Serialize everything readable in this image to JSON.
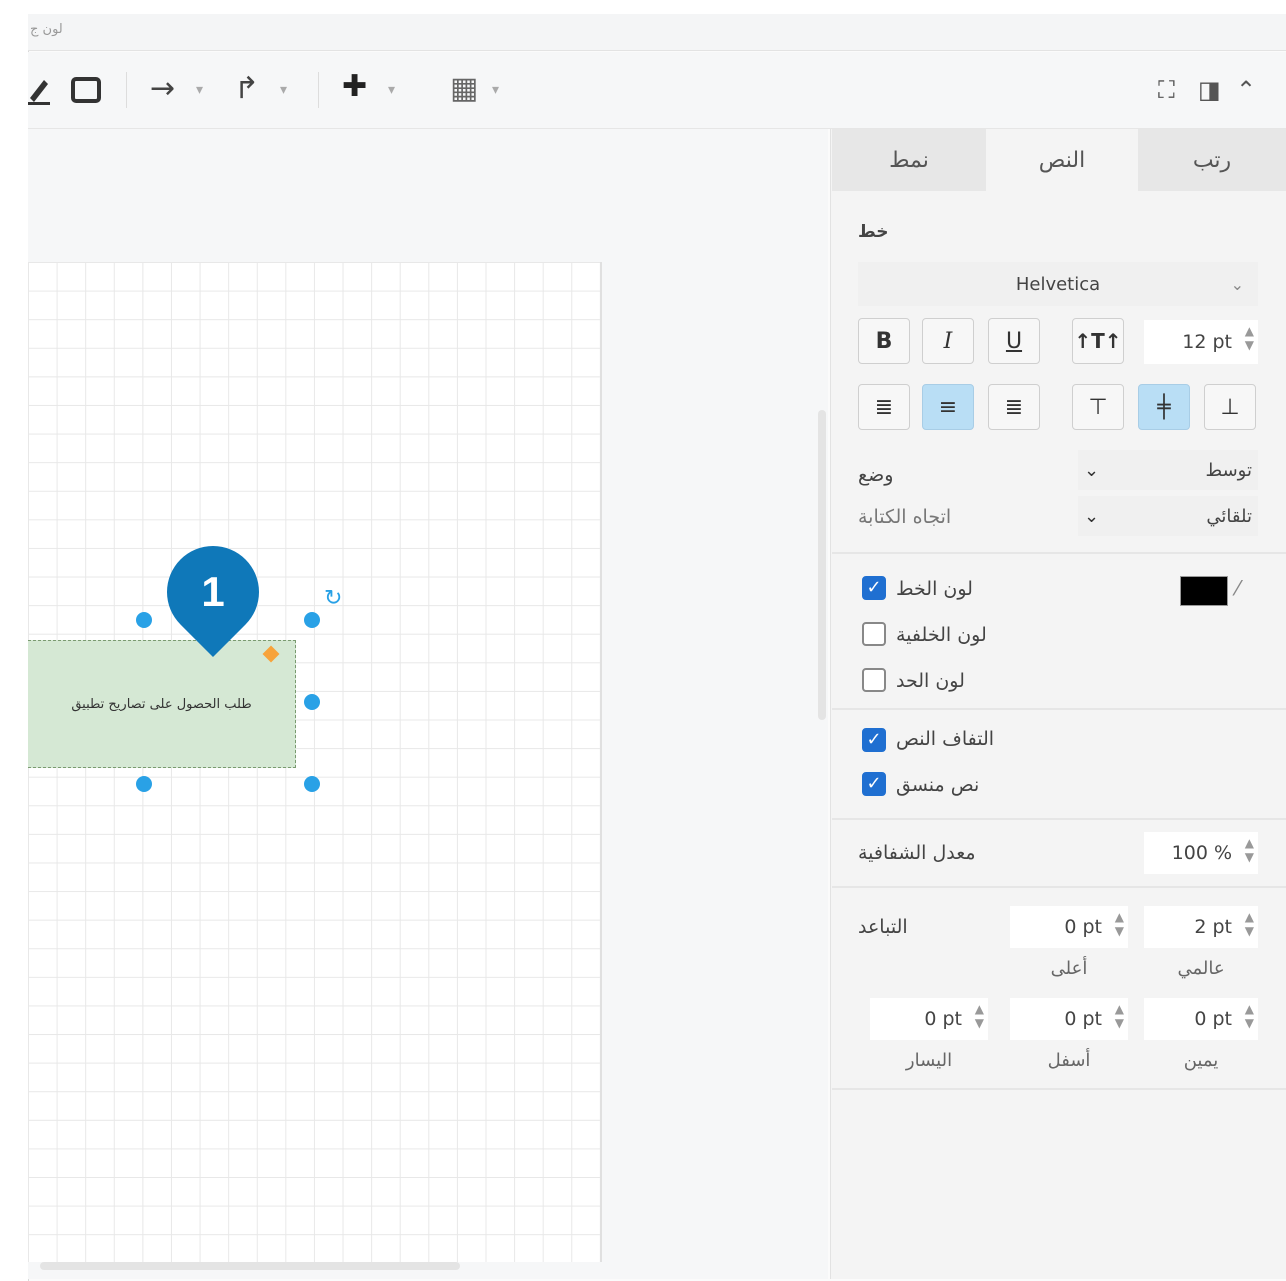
{
  "window": {
    "title": "لون ج"
  },
  "toolbar": {
    "pencil_icon": "pencil-icon",
    "rect_icon": "rectangle-icon",
    "arrow_icon": "→",
    "waypoint_icon": "↱",
    "plus_icon": "✚",
    "table_icon": "▦",
    "dropdown": "▾",
    "right_icons": [
      "⛶",
      "◨",
      "⌃"
    ]
  },
  "canvas": {
    "shape_label": "طلب الحصول على تصاريح تطبيق",
    "callout_number": "1",
    "colors": {
      "shape_fill": "#d5e8d4",
      "handle": "#29a1e6",
      "callout": "#0f78b9"
    }
  },
  "panel": {
    "tabs": [
      {
        "label": "نمط"
      },
      {
        "label": "النص"
      },
      {
        "label": "رتب"
      }
    ],
    "font_section_label": "خط",
    "font_family": "Helvetica",
    "format_buttons": {
      "bold": "B",
      "italic": "I",
      "underline": "U"
    },
    "font_size": "12 pt",
    "position_label": "وضع",
    "position_value": "توسط",
    "writing_direction_label": "اتجاه الكتابة",
    "writing_direction_value": "تلقائي",
    "font_color_label": "لون الخط",
    "background_color_label": "لون الخلفية",
    "border_color_label": "لون الحد",
    "word_wrap_label": "التفاف النص",
    "formatted_text_label": "نص منسق",
    "opacity_label": "معدل الشفافية",
    "opacity_value": "100 %",
    "spacing_label": "التباعد",
    "spacing_top_value": "0 pt",
    "spacing_global_value": "2 pt",
    "spacing_top_caption": "أعلى",
    "spacing_global_caption": "عالمي",
    "spacing_left_value": "0 pt",
    "spacing_bottom_value": "0 pt",
    "spacing_right_value": "0 pt",
    "spacing_left_caption": "اليسار",
    "spacing_bottom_caption": "أسفل",
    "spacing_right_caption": "يمين",
    "font_color_hex": "#000000",
    "accent_color": "#1f6fd1"
  }
}
